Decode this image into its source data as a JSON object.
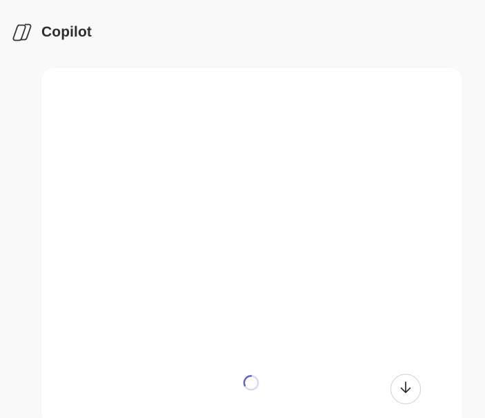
{
  "app": {
    "title": "Copilot",
    "logo_icon": "copilot-logo-icon"
  },
  "chat": {
    "loading_icon": "loading-spinner-icon",
    "scroll_button_icon": "arrow-down-icon"
  },
  "colors": {
    "background": "#f9f9f9",
    "panel": "#ffffff",
    "spinner": "#5b5fc7",
    "text": "#2e2e2e"
  }
}
